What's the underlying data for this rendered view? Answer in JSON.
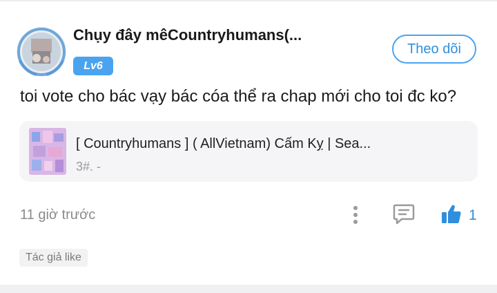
{
  "post": {
    "username": "Chụy đây mêCountryhumans(...",
    "level": "Lv6",
    "follow_label": "Theo dõi",
    "comment": "toi vote cho bác vạy bác cóa thể ra chap mới cho toi đc ko?",
    "card": {
      "title": "[ Countryhumans ] ( AllVietnam) Cấm Kỵ | Sea...",
      "subtitle": "3#. -"
    },
    "time": "11 giờ trước",
    "like_count": "1",
    "author_like": "Tác giả like"
  },
  "icons": {
    "more": "more-vertical-icon",
    "reply": "chat-bubble-icon",
    "like": "thumbs-up-icon"
  },
  "colors": {
    "accent": "#4aa3ef",
    "text": "#1a1a1a",
    "muted": "#8a8a8a",
    "card_bg": "#f5f5f7"
  }
}
